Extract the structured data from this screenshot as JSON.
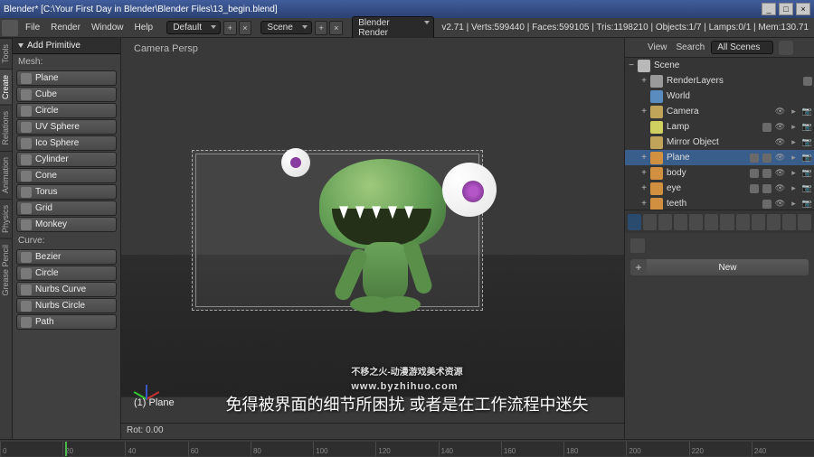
{
  "titlebar": {
    "title": "Blender* [C:\\Your First Day in Blender\\Blender Files\\13_begin.blend]",
    "min": "_",
    "max": "□",
    "close": "×"
  },
  "topmenu": {
    "file": "File",
    "render": "Render",
    "window": "Window",
    "help": "Help"
  },
  "layout_dropdown": "Default",
  "scene_dropdown": "Scene",
  "engine_dropdown": "Blender Render",
  "stats": "v2.71 | Verts:599440 | Faces:599105 | Tris:1198210 | Objects:1/7 | Lamps:0/1 | Mem:130.71",
  "tool_header": "Add Primitive",
  "tool_section_mesh": "Mesh:",
  "tool_section_curve": "Curve:",
  "mesh_primitives": [
    "Plane",
    "Cube",
    "Circle",
    "UV Sphere",
    "Ico Sphere",
    "Cylinder",
    "Cone",
    "Torus",
    "Grid",
    "Monkey"
  ],
  "curve_primitives": [
    "Bezier",
    "Circle",
    "Nurbs Curve",
    "Nurbs Circle",
    "Path"
  ],
  "left_tabs": [
    "Tools",
    "Create",
    "Relations",
    "Animation",
    "Physics",
    "Grease Pencil"
  ],
  "viewport": {
    "persp": "Camera Persp",
    "object_label": "(1) Plane",
    "footer": "Rot: 0.00"
  },
  "outliner": {
    "view": "View",
    "search": "Search",
    "filter": "All Scenes",
    "tree": [
      {
        "depth": 0,
        "exp": "−",
        "name": "Scene",
        "ic": "#b8b8b8",
        "sel": false,
        "toggles": false
      },
      {
        "depth": 1,
        "exp": "+",
        "name": "RenderLayers",
        "ic": "#9a9a9a",
        "sel": false,
        "extra": 1,
        "toggles": false
      },
      {
        "depth": 1,
        "exp": "",
        "name": "World",
        "ic": "#5a8cc0",
        "sel": false,
        "toggles": false
      },
      {
        "depth": 1,
        "exp": "+",
        "name": "Camera",
        "ic": "#c0a45a",
        "sel": false,
        "toggles": true
      },
      {
        "depth": 1,
        "exp": "",
        "name": "Lamp",
        "ic": "#d0d060",
        "sel": false,
        "extra": 1,
        "toggles": true
      },
      {
        "depth": 1,
        "exp": "",
        "name": "Mirror Object",
        "ic": "#c0a45a",
        "sel": false,
        "toggles": true
      },
      {
        "depth": 1,
        "exp": "+",
        "name": "Plane",
        "ic": "#d09040",
        "sel": true,
        "extra": 2,
        "toggles": true
      },
      {
        "depth": 1,
        "exp": "+",
        "name": "body",
        "ic": "#d09040",
        "sel": false,
        "extra": 2,
        "toggles": true
      },
      {
        "depth": 1,
        "exp": "+",
        "name": "eye",
        "ic": "#d09040",
        "sel": false,
        "extra": 2,
        "toggles": true
      },
      {
        "depth": 1,
        "exp": "+",
        "name": "teeth",
        "ic": "#d09040",
        "sel": false,
        "extra": 1,
        "toggles": true
      }
    ]
  },
  "props": {
    "new_btn": "New",
    "plus": "+"
  },
  "timeline_ticks": [
    "0",
    "20",
    "40",
    "60",
    "80",
    "100",
    "120",
    "140",
    "160",
    "180",
    "200",
    "220",
    "240"
  ],
  "watermark": "不移之火-动漫游戏美术资源",
  "watermark_url": "www.byzhihuo.com",
  "subtitle": "免得被界面的细节所困扰  或者是在工作流程中迷失"
}
